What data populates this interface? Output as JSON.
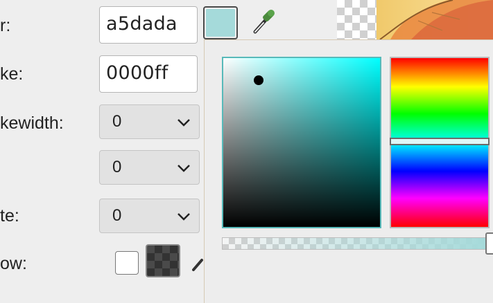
{
  "labels": {
    "fill": "r:",
    "stroke": "ke:",
    "strokewidth": "kewidth:",
    "rotate": "te:",
    "shadow": "ow:"
  },
  "fields": {
    "fill_hex": "a5dada",
    "stroke_hex": "0000ff"
  },
  "combos": {
    "strokewidth": "0",
    "blank": "0",
    "rotate": "0"
  },
  "colors": {
    "fill": "#a5dada",
    "stroke": "#0000ff",
    "picker_hue": "#00ffff"
  },
  "icons": {
    "eyedropper": "eyedropper-icon",
    "chevron": "chevron-down-icon"
  },
  "picker": {
    "alpha_percent": 100
  }
}
